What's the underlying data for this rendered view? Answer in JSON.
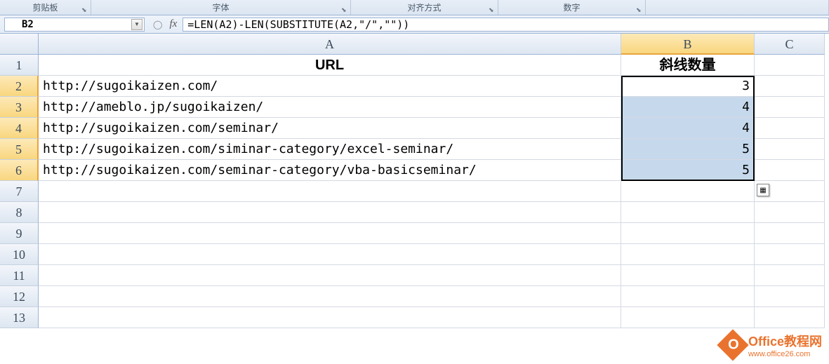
{
  "ribbon": {
    "clipboard": "剪贴板",
    "font": "字体",
    "alignment": "对齐方式",
    "number": "数字"
  },
  "namebox": "B2",
  "formula": "=LEN(A2)-LEN(SUBSTITUTE(A2,\"/\",\"\"))",
  "columns": {
    "A": "A",
    "B": "B",
    "C": "C"
  },
  "headers": {
    "url": "URL",
    "slashcount": "斜线数量"
  },
  "rows": [
    {
      "n": "1"
    },
    {
      "n": "2",
      "url": "http://sugoikaizen.com/",
      "count": "3"
    },
    {
      "n": "3",
      "url": "http://ameblo.jp/sugoikaizen/",
      "count": "4"
    },
    {
      "n": "4",
      "url": "http://sugoikaizen.com/seminar/",
      "count": "4"
    },
    {
      "n": "5",
      "url": "http://sugoikaizen.com/siminar-category/excel-seminar/",
      "count": "5"
    },
    {
      "n": "6",
      "url": "http://sugoikaizen.com/seminar-category/vba-basicseminar/",
      "count": "5"
    },
    {
      "n": "7"
    },
    {
      "n": "8"
    },
    {
      "n": "9"
    },
    {
      "n": "10"
    },
    {
      "n": "11"
    },
    {
      "n": "12"
    },
    {
      "n": "13"
    }
  ],
  "watermark": {
    "line1": "Office教程网",
    "line2": "www.office26.com"
  }
}
